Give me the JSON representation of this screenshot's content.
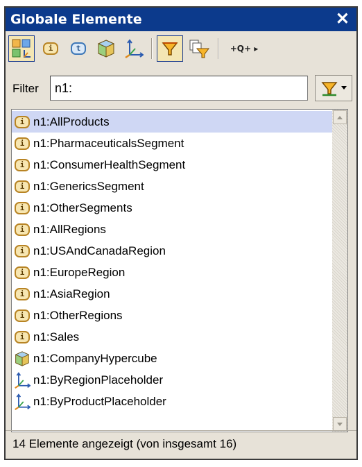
{
  "panel": {
    "title": "Globale Elemente",
    "close_label": "✕"
  },
  "toolbar": {
    "buttons": [
      {
        "name": "show-all-icon",
        "active": true
      },
      {
        "name": "item-icon"
      },
      {
        "name": "tuple-icon"
      },
      {
        "name": "hypercube-icon"
      },
      {
        "name": "dimension-icon"
      },
      {
        "name": "filter-icon",
        "active": true
      },
      {
        "name": "filter-options-icon"
      },
      {
        "name": "expand-nav-icon",
        "label": "+Q+ ▸"
      }
    ]
  },
  "filter": {
    "label": "Filter",
    "value": "n1:"
  },
  "items": [
    {
      "type": "item",
      "label": "n1:AllProducts",
      "selected": true
    },
    {
      "type": "item",
      "label": "n1:PharmaceuticalsSegment"
    },
    {
      "type": "item",
      "label": "n1:ConsumerHealthSegment"
    },
    {
      "type": "item",
      "label": "n1:GenericsSegment"
    },
    {
      "type": "item",
      "label": "n1:OtherSegments"
    },
    {
      "type": "item",
      "label": "n1:AllRegions"
    },
    {
      "type": "item",
      "label": "n1:USAndCanadaRegion"
    },
    {
      "type": "item",
      "label": "n1:EuropeRegion"
    },
    {
      "type": "item",
      "label": "n1:AsiaRegion"
    },
    {
      "type": "item",
      "label": "n1:OtherRegions"
    },
    {
      "type": "item",
      "label": "n1:Sales"
    },
    {
      "type": "hypercube",
      "label": "n1:CompanyHypercube"
    },
    {
      "type": "dimension",
      "label": "n1:ByRegionPlaceholder"
    },
    {
      "type": "dimension",
      "label": "n1:ByProductPlaceholder"
    }
  ],
  "status": {
    "text": "14 Elemente angezeigt (von insgesamt 16)"
  },
  "colors": {
    "titlebar": "#0c3a8c",
    "selection": "#cfd7f4",
    "item_badge": "#f7e6b1"
  }
}
